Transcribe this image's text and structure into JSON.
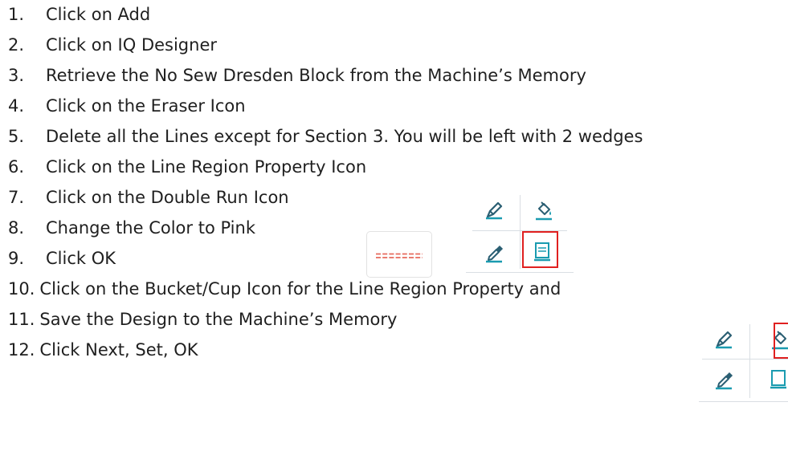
{
  "steps": [
    {
      "number": "1.",
      "text": "Click on Add"
    },
    {
      "number": "2.",
      "text": "Click on IQ Designer"
    },
    {
      "number": "3.",
      "text": "Retrieve the No Sew Dresden Block from the Machine’s Memory"
    },
    {
      "number": "4.",
      "text": "Click on the Eraser Icon"
    },
    {
      "number": "5.",
      "text": "Delete all the Lines except for Section 3. You will be left with 2 wedges"
    },
    {
      "number": "6.",
      "text": "Click on the Line Region Property Icon"
    },
    {
      "number": "7.",
      "text": "Click on the Double Run Icon"
    },
    {
      "number": "8.",
      "text": "Change the Color to Pink"
    },
    {
      "number": "9.",
      "text": "Click OK"
    },
    {
      "number": "10.",
      "text": "Click on the Bucket/Cup Icon for the Line Region Property and"
    },
    {
      "number": "11.",
      "text": "Save the Design to the Machine’s Memory"
    },
    {
      "number": "12.",
      "text": "Click Next, Set, OK"
    }
  ],
  "icons": {
    "property_panel_1": [
      "line-pen-icon",
      "fill-bucket-icon",
      "eyedropper-icon",
      "line-region-property-icon"
    ],
    "double_run_button": "double-run-line-icon",
    "property_panel_2": [
      "line-pen-icon",
      "fill-bucket-icon",
      "eyedropper-icon",
      "region-property-icon"
    ]
  },
  "colors": {
    "icon_teal": "#1a9bb0",
    "icon_dark": "#2b5f73",
    "highlight_red": "#e02020",
    "double_run_dash": "#e66a5c"
  }
}
